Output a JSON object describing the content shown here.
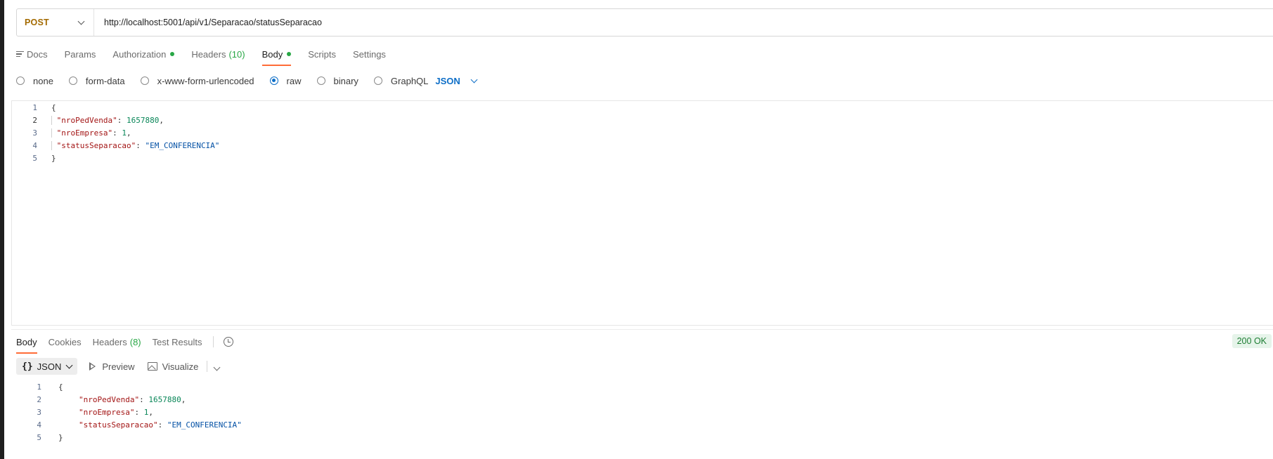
{
  "request": {
    "method": "POST",
    "url": "http://localhost:5001/api/v1/Separacao/statusSeparacao"
  },
  "request_tabs": {
    "docs": "Docs",
    "params": "Params",
    "authorization": "Authorization",
    "headers": "Headers",
    "headers_count": "(10)",
    "body": "Body",
    "scripts": "Scripts",
    "settings": "Settings"
  },
  "body_types": {
    "none": "none",
    "form_data": "form-data",
    "urlencoded": "x-www-form-urlencoded",
    "raw": "raw",
    "binary": "binary",
    "graphql": "GraphQL",
    "selected": "raw",
    "language": "JSON"
  },
  "request_body": {
    "line_numbers": [
      "1",
      "2",
      "3",
      "4",
      "5"
    ],
    "open": "{",
    "close": "}",
    "k1": "\"nroPedVenda\"",
    "v1": "1657880",
    "k2": "\"nroEmpresa\"",
    "v2": "1",
    "k3": "\"statusSeparacao\"",
    "v3": "\"EM_CONFERENCIA\""
  },
  "response_tabs": {
    "body": "Body",
    "cookies": "Cookies",
    "headers": "Headers",
    "headers_count": "(8)",
    "test_results": "Test Results"
  },
  "response": {
    "status": "200 OK",
    "format": "JSON",
    "preview": "Preview",
    "visualize": "Visualize"
  },
  "response_body": {
    "line_numbers": [
      "1",
      "2",
      "3",
      "4",
      "5"
    ],
    "open": "{",
    "close": "}",
    "k1": "\"nroPedVenda\"",
    "v1": "1657880",
    "k2": "\"nroEmpresa\"",
    "v2": "1",
    "k3": "\"statusSeparacao\"",
    "v3": "\"EM_CONFERENCIA\""
  },
  "colors": {
    "method": "#a36a00",
    "accent": "#ff6c37",
    "link": "#0d6ec7",
    "success": "#28a745"
  }
}
